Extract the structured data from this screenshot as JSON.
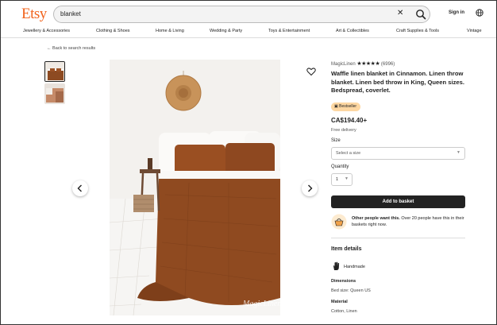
{
  "header": {
    "logo": "Etsy",
    "search_value": "blanket",
    "clear_glyph": "✕",
    "signin": "Sign in",
    "accent_color": "#f1641e"
  },
  "nav": {
    "items": [
      "Jewellery & Accessories",
      "Clothing & Shoes",
      "Home & Living",
      "Wedding & Party",
      "Toys & Entertainment",
      "Art & Collectibles",
      "Craft Supplies & Tools",
      "Vintage"
    ]
  },
  "back_link": "← Back to search results",
  "listing": {
    "shop_name": "MagicLinen",
    "stars": "★★★★★",
    "review_count": "(6996)",
    "title": "Waffle linen blanket in Cinnamon. Linen throw blanket. Linen bed throw in King, Queen sizes. Bedspread, coverlet.",
    "badge": "Bestseller",
    "price": "CA$194.40+",
    "delivery": "Free delivery",
    "size_label": "Size",
    "size_placeholder": "Select a size",
    "quantity_label": "Quantity",
    "quantity_value": "1",
    "add_to_basket": "Add to basket",
    "others_bold": "Other people want this.",
    "others_rest": " Over 20 people have this in their baskets right now.",
    "item_details_title": "Item details",
    "handmade": "Handmade",
    "dimensions_title": "Dimensions",
    "dimensions_value": "Bed size: Queen US",
    "material_title": "Material",
    "material_value": "Cotton, Linen",
    "watermark": "MagicLinen"
  },
  "icons": {
    "search": "search-icon",
    "globe": "globe-icon",
    "heart": "heart-icon",
    "basket": "basket-icon",
    "hand": "hand-icon",
    "prev": "chevron-left-icon",
    "next": "chevron-right-icon"
  }
}
